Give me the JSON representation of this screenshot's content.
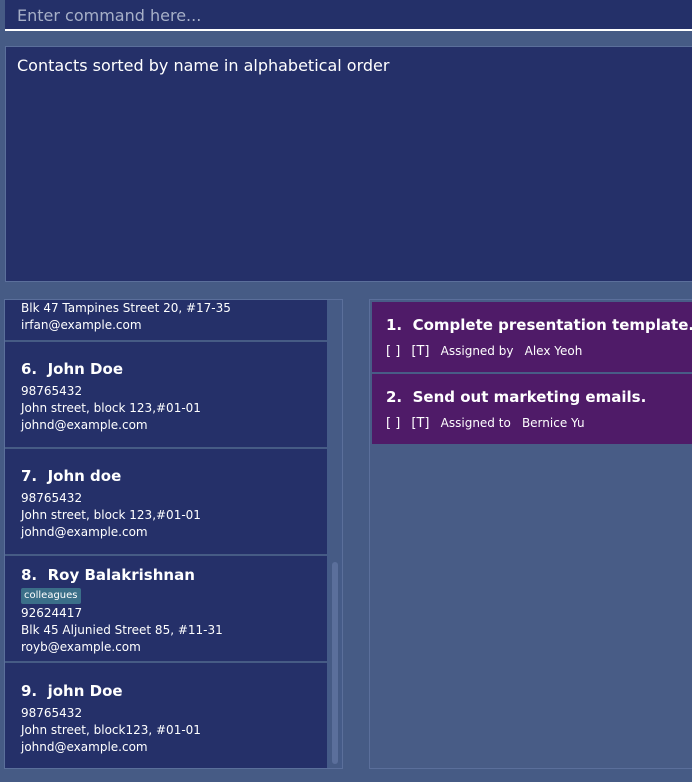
{
  "command_box": {
    "placeholder": "Enter command here..."
  },
  "result_display": {
    "text": "Contacts sorted by name in alphabetical order"
  },
  "contacts": [
    {
      "address": "Blk 47 Tampines Street 20, #17-35",
      "email": "irfan@example.com"
    },
    {
      "index": "6.",
      "name": "John Doe",
      "phone": "98765432",
      "address": "John street, block 123,#01-01",
      "email": "johnd@example.com"
    },
    {
      "index": "7.",
      "name": "John doe",
      "phone": "98765432",
      "address": "John street, block 123,#01-01",
      "email": "johnd@example.com"
    },
    {
      "index": "8.",
      "name": "Roy Balakrishnan",
      "tag": "colleagues",
      "phone": "92624417",
      "address": "Blk 45 Aljunied Street 85, #11-31",
      "email": "royb@example.com"
    },
    {
      "index": "9.",
      "name": "john Doe",
      "phone": "98765432",
      "address": "John street, block123, #01-01",
      "email": "johnd@example.com"
    }
  ],
  "tasks": [
    {
      "index": "1.",
      "title": "Complete presentation template.",
      "status": "[ ]",
      "type": "[T]",
      "relation": "Assigned by",
      "person": "Alex Yeoh"
    },
    {
      "index": "2.",
      "title": "Send out marketing emails.",
      "status": "[ ]",
      "type": "[T]",
      "relation": "Assigned to",
      "person": "Bernice Yu"
    }
  ],
  "colors": {
    "background": "#465b85",
    "panel": "#253069",
    "task_card": "#4f1b68",
    "tag": "#3b6f89"
  }
}
